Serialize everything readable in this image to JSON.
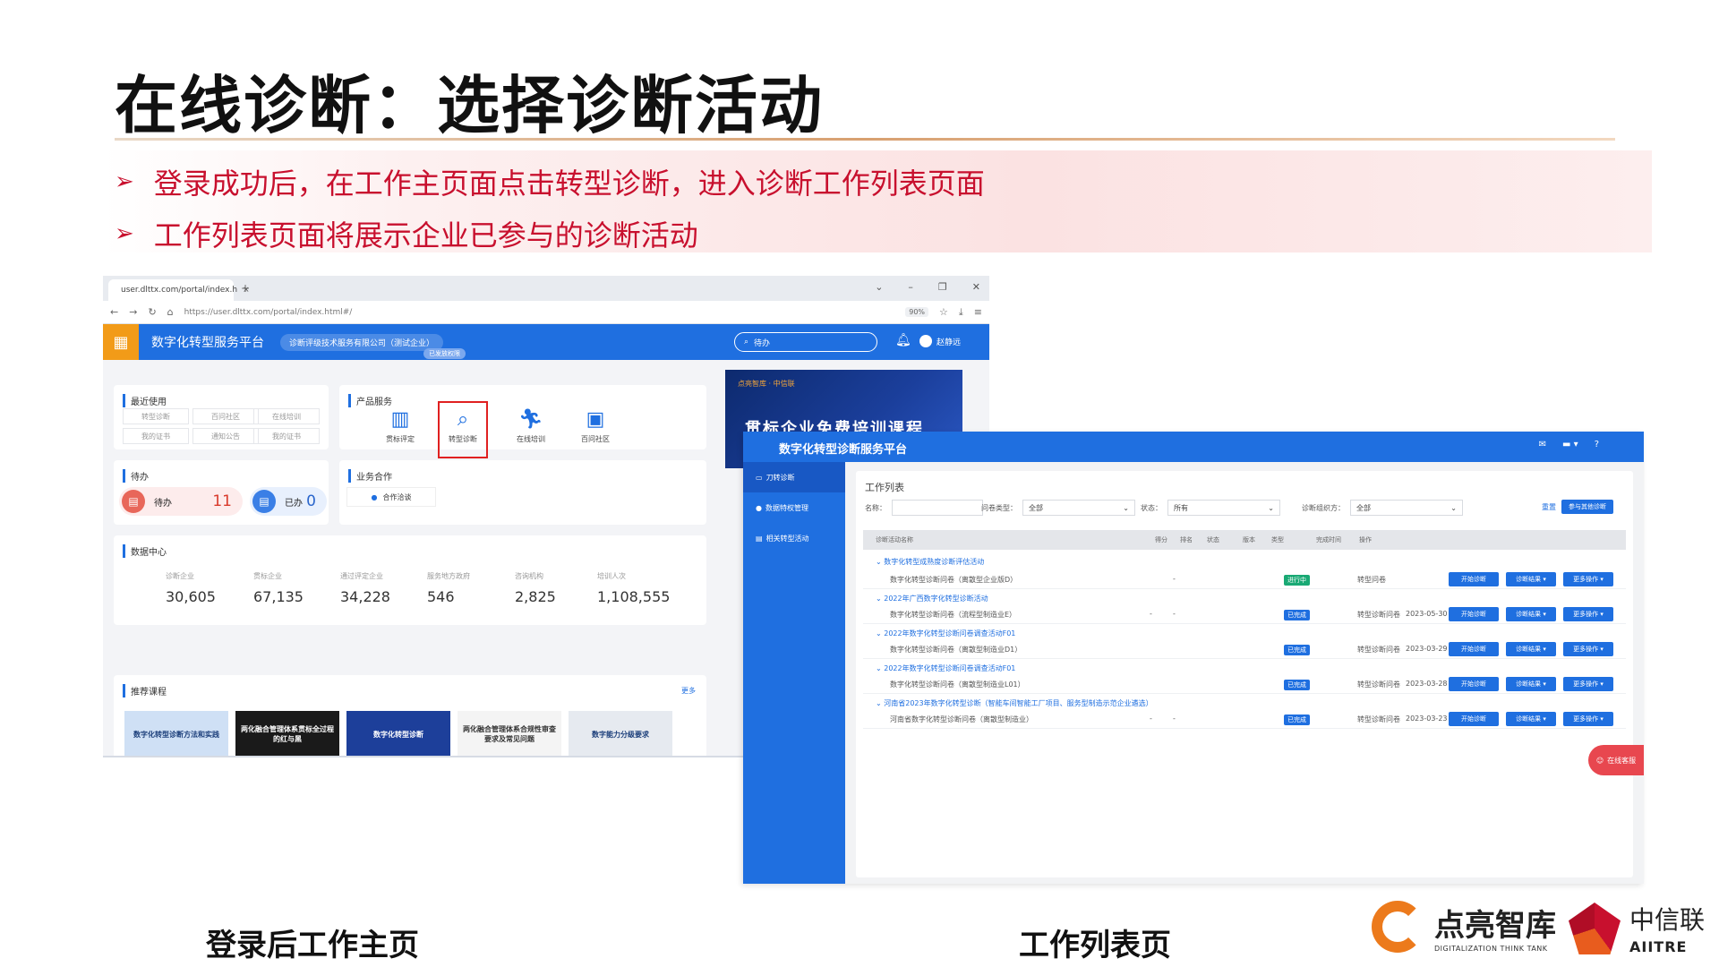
{
  "slide": {
    "title": "在线诊断：选择诊断活动",
    "bullets": [
      "登录成功后，在工作主页面点击转型诊断，进入诊断工作列表页面",
      "工作列表页面将展示企业已参与的诊断活动"
    ],
    "bullet_marker": "➢",
    "caption_left": "登录后工作主页",
    "caption_right": "工作列表页"
  },
  "browser": {
    "tab_title": "user.dlttx.com/portal/index.h",
    "tab_close": "×",
    "new_tab": "+",
    "window_controls": [
      "⌄",
      "–",
      "❐",
      "✕"
    ],
    "url": "https://user.dlttx.com/portal/index.html#/",
    "zoom": "90%"
  },
  "home": {
    "app_name": "数字化转型服务平台",
    "org": "诊断评级技术服务有限公司（测试企业）",
    "org_sub": "已发放权限",
    "search_placeholder": "待办",
    "user_name": "赵静远",
    "recent": {
      "title": "最近使用",
      "items": [
        "转型诊断",
        "百问社区",
        "在线培训",
        "我的证书",
        "通知公告",
        "我的证书"
      ]
    },
    "products": {
      "title": "产品服务",
      "items": [
        {
          "label": "贯标评定",
          "icon": "building-icon"
        },
        {
          "label": "转型诊断",
          "icon": "search-icon",
          "selected": true
        },
        {
          "label": "在线培训",
          "icon": "runner-icon"
        },
        {
          "label": "百问社区",
          "icon": "community-icon"
        }
      ]
    },
    "todo": {
      "title": "待办",
      "pending_label": "待办",
      "pending_count": "11",
      "done_label": "已办",
      "done_count": "0"
    },
    "business": {
      "title": "业务合作",
      "item": "合作洽谈"
    },
    "data_center": {
      "title": "数据中心",
      "stats": [
        {
          "label": "诊断企业",
          "value": "30,605"
        },
        {
          "label": "贯标企业",
          "value": "67,135"
        },
        {
          "label": "通过评定企业",
          "value": "34,228"
        },
        {
          "label": "服务地方政府",
          "value": "546"
        },
        {
          "label": "咨询机构",
          "value": "2,825"
        },
        {
          "label": "培训人次",
          "value": "1,108,555"
        }
      ]
    },
    "courses": {
      "title": "推荐课程",
      "more": "更多",
      "items": [
        "数字化转型诊断方法和实践",
        "两化融合管理体系贯标全过程的红与黑",
        "数字化转型诊断",
        "两化融合管理体系合规性审查要求及常见问题",
        "数字能力分级要求"
      ]
    },
    "banner_title": "贯标企业免费培训课程",
    "banner_logos": "点亮智库 · 中信联"
  },
  "worklist": {
    "app_name": "数字化转型诊断服务平台",
    "sidebar": [
      "刀转诊断",
      "数据特权管理",
      "相关转型活动"
    ],
    "page_title": "工作列表",
    "filters": {
      "name_label": "名称：",
      "type_label": "问卷类型：",
      "type_value": "全部",
      "status_label": "状态：",
      "status_value": "所有",
      "org_label": "诊断组织方：",
      "org_value": "全部",
      "reset": "重置",
      "join_button": "参与其他诊断"
    },
    "columns": [
      "诊断活动名称",
      "得分",
      "排名",
      "状态",
      "版本",
      "类型",
      "完成时间",
      "操作"
    ],
    "groups": [
      {
        "name": "数字化转型成熟度诊断评估活动",
        "row": {
          "name": "数字化转型诊断问卷（离散型企业版D）",
          "score": "-",
          "rank": "",
          "status": "进行中",
          "status_color": "#19a974",
          "type": "转型问卷",
          "date": ""
        }
      },
      {
        "name": "2022年广西数字化转型诊断活动",
        "row": {
          "name": "数字化转型诊断问卷（流程型制造业E）",
          "score": "-",
          "rank": "-",
          "status": "已完成",
          "status_color": "#1f6fe0",
          "type": "转型诊断问卷",
          "date": "2023-05-30"
        }
      },
      {
        "name": "2022年数字化转型诊断问卷调查活动F01",
        "row": {
          "name": "数字化转型诊断问卷（离散型制造业D1）",
          "score": "",
          "rank": "",
          "status": "已完成",
          "status_color": "#1f6fe0",
          "type": "转型诊断问卷",
          "date": "2023-03-29"
        }
      },
      {
        "name": "2022年数字化转型诊断问卷调查活动F01",
        "row": {
          "name": "数字化转型诊断问卷（离散型制造业L01）",
          "score": "",
          "rank": "",
          "status": "已完成",
          "status_color": "#1f6fe0",
          "type": "转型诊断问卷",
          "date": "2023-03-28"
        }
      },
      {
        "name": "河南省2023年数字化转型诊断（智能车间智能工厂项目、服务型制造示范企业遴选）",
        "row": {
          "name": "河南省数字化转型诊断问卷（离散型制造业）",
          "score": "-",
          "rank": "-",
          "status": "已完成",
          "status_color": "#1f6fe0",
          "type": "转型诊断问卷",
          "date": "2023-03-23"
        }
      }
    ],
    "row_actions": [
      "开始诊断",
      "诊断结果 ▾",
      "更多操作 ▾"
    ],
    "help_float": "在线客服"
  },
  "branding": {
    "logo1_cn": "点亮智库",
    "logo1_en": "DIGITALIZATION THINK TANK",
    "logo2_cn": "中信联",
    "logo2_en": "AIITRE",
    "accent": "#c8102e",
    "brand_blue": "#1f6fe0"
  }
}
